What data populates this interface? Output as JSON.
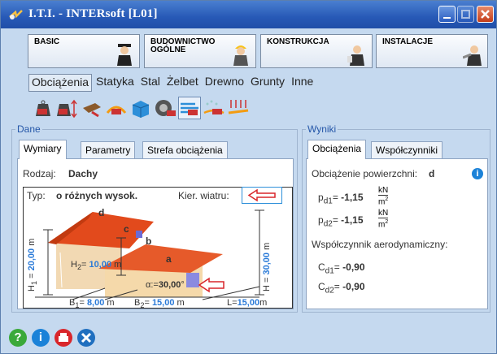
{
  "window": {
    "title": "I.T.I. - INTERsoft [L01]"
  },
  "categories": [
    {
      "label": "BASIC"
    },
    {
      "label": "BUDOWNICTWO\nOGÓLNE"
    },
    {
      "label": "KONSTRUKCJA"
    },
    {
      "label": "INSTALACJE"
    }
  ],
  "menu": [
    "Obciążenia",
    "Statyka",
    "Stal",
    "Żelbet",
    "Drewno",
    "Grunty",
    "Inne"
  ],
  "toolbar": {
    "icons": [
      "weight-icon",
      "weight-arrows-icon",
      "beam-load-icon",
      "pn-load-icon",
      "cube-load-icon",
      "wheel-load-icon",
      "wind-pn-icon",
      "snow-pn-icon",
      "lightning-load-icon"
    ]
  },
  "left": {
    "group_label": "Dane",
    "tabs": [
      "Wymiary",
      "Parametry",
      "Strefa obciążenia"
    ],
    "rodzaj_label": "Rodzaj:",
    "rodzaj_value": "Dachy",
    "typ_label": "Typ:",
    "typ_value": "o różnych wysok.",
    "kier_label": "Kier. wiatru:",
    "dims": {
      "H1": "H",
      "H1v": "1",
      "H1val": "20,00",
      "H1u": "m",
      "H2": "H",
      "H2v": "2",
      "H2eq": "=",
      "H2val": "10,00",
      "H2u": "m",
      "H3": "H",
      "H3val": "30,00",
      "H3u": "m",
      "B1": "B",
      "B1v": "1",
      "B1eq": "=",
      "B1val": "8,00",
      "B1u": "m",
      "B2": "B",
      "B2v": "2",
      "B2eq": "=",
      "B2val": "15,00",
      "B2u": "m",
      "L": "L",
      "Leq": "=",
      "Lval": "15,00",
      "Lu": "m",
      "alpha": "α:",
      "alphaVal": "30,00",
      "alphaU": "°",
      "roof_a": "a",
      "roof_b": "b",
      "roof_c": "c",
      "roof_d": "d",
      "eq": "="
    }
  },
  "right": {
    "group_label": "Wyniki",
    "tabs": [
      "Obciążenia",
      "Współczynniki"
    ],
    "obc_label": "Obciążenie powierzchni:",
    "obc_value": "d",
    "pd1": "p",
    "pd1sub": "d1",
    "pd1eq": "=",
    "pd1val": "-1,15",
    "pd1num": "kN",
    "pd1den": "m",
    "pd2": "p",
    "pd2sub": "d2",
    "pd2eq": "=",
    "pd2val": "-1,15",
    "pd2num": "kN",
    "pd2den": "m",
    "sq": "2",
    "wsp_label": "Współczynnik aerodynamiczny:",
    "cd1": "C",
    "cd1sub": "d1",
    "cd1eq": "=",
    "cd1val": "-0,90",
    "cd2": "C",
    "cd2sub": "d2",
    "cd2eq": "=",
    "cd2val": "-0,90",
    "info": "i"
  },
  "bottom": {
    "icons": [
      "help-icon",
      "info-icon",
      "print-icon",
      "tools-icon"
    ],
    "help": "?",
    "info": "i"
  }
}
